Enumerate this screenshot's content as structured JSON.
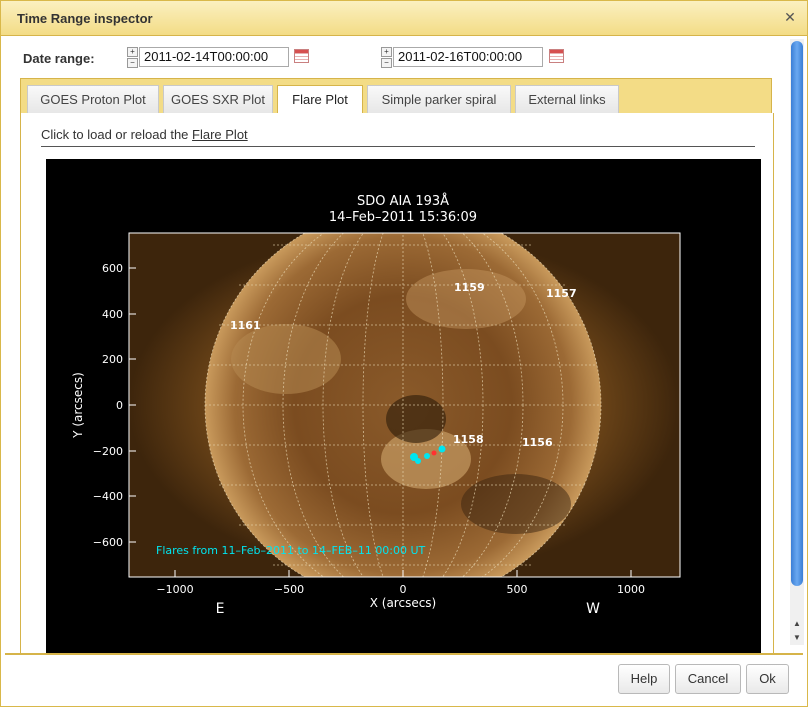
{
  "dialog": {
    "title": "Time Range inspector",
    "close_icon": "close-icon"
  },
  "date_range": {
    "label": "Date range:",
    "start": "2011-02-14T00:00:00",
    "end": "2011-02-16T00:00:00",
    "calendar_icon": "calendar-icon"
  },
  "tabs": [
    {
      "label": "GOES Proton Plot"
    },
    {
      "label": "GOES SXR Plot"
    },
    {
      "label": "Flare Plot",
      "active": true
    },
    {
      "label": "Simple parker spiral"
    },
    {
      "label": "External links"
    }
  ],
  "panel": {
    "load_prefix": "Click to load or reload the ",
    "load_link": "Flare Plot"
  },
  "plot": {
    "title": "SDO AIA 193Å",
    "datetime": "14–Feb–2011 15:36:09",
    "xlabel": "X (arcsecs)",
    "ylabel": "Y (arcsecs)",
    "x_ticks": [
      "−1000",
      "−500",
      "0",
      "500",
      "1000"
    ],
    "y_ticks": [
      "600",
      "400",
      "200",
      "0",
      "−200",
      "−400",
      "−600"
    ],
    "east": "E",
    "west": "W",
    "regions": [
      "1159",
      "1157",
      "1161",
      "1158",
      "1156"
    ],
    "flares_note": "Flares from 11–Feb–2011 to 14–FEB–11 00:00 UT"
  },
  "buttons": {
    "help": "Help",
    "cancel": "Cancel",
    "ok": "Ok"
  },
  "colors": {
    "accent": "#f3dc86",
    "border": "#d6b44a",
    "scroll_thumb": "#3b7fd6",
    "flare_marker": "#00e5f0"
  }
}
